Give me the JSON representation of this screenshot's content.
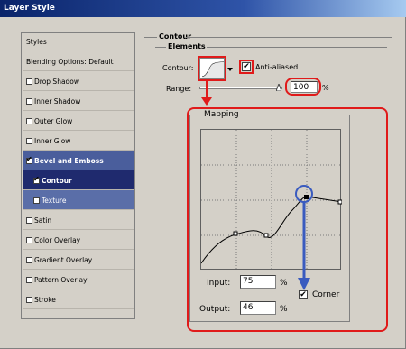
{
  "window": {
    "title": "Layer Style"
  },
  "styles_list": {
    "header": "Styles",
    "items": [
      {
        "label": "Blending Options: Default",
        "checkbox": false,
        "checked": false,
        "state": "normal"
      },
      {
        "label": "Drop Shadow",
        "checkbox": true,
        "checked": false,
        "state": "normal"
      },
      {
        "label": "Inner Shadow",
        "checkbox": true,
        "checked": false,
        "state": "normal"
      },
      {
        "label": "Outer Glow",
        "checkbox": true,
        "checked": false,
        "state": "normal"
      },
      {
        "label": "Inner Glow",
        "checkbox": true,
        "checked": false,
        "state": "normal"
      },
      {
        "label": "Bevel and Emboss",
        "checkbox": true,
        "checked": true,
        "state": "selected"
      },
      {
        "label": "Contour",
        "checkbox": true,
        "checked": true,
        "state": "sub-selected"
      },
      {
        "label": "Texture",
        "checkbox": true,
        "checked": false,
        "state": "sub"
      },
      {
        "label": "Satin",
        "checkbox": true,
        "checked": false,
        "state": "normal"
      },
      {
        "label": "Color Overlay",
        "checkbox": true,
        "checked": false,
        "state": "normal"
      },
      {
        "label": "Gradient Overlay",
        "checkbox": true,
        "checked": false,
        "state": "normal"
      },
      {
        "label": "Pattern Overlay",
        "checkbox": true,
        "checked": false,
        "state": "normal"
      },
      {
        "label": "Stroke",
        "checkbox": true,
        "checked": false,
        "state": "normal"
      }
    ]
  },
  "contour_panel": {
    "section_title": "Contour",
    "elements_title": "Elements",
    "contour_label": "Contour:",
    "anti_aliased_label": "Anti-aliased",
    "anti_aliased_checked": true,
    "range_label": "Range:",
    "range_value": "100",
    "range_unit": "%"
  },
  "mapping": {
    "title": "Mapping",
    "input_label": "Input:",
    "input_value": "75",
    "input_unit": "%",
    "output_label": "Output:",
    "output_value": "46",
    "output_unit": "%",
    "corner_label": "Corner",
    "corner_checked": true
  },
  "colors": {
    "annotation_red": "#e01a1a",
    "annotation_blue": "#3a5bbf",
    "selected_bg": "#4a5e9c"
  }
}
